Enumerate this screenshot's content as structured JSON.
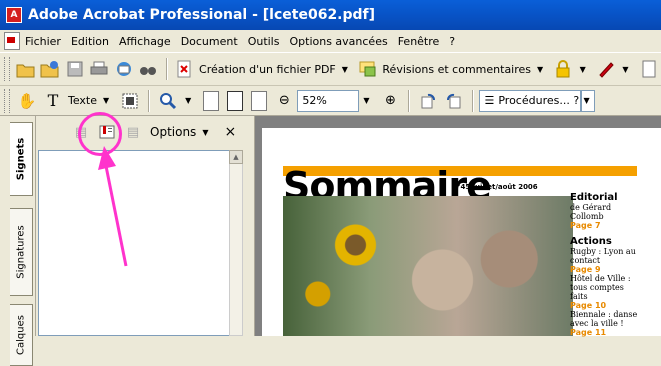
{
  "window": {
    "title": "Adobe Acrobat Professional - [lcete062.pdf]"
  },
  "menu": [
    "Fichier",
    "Edition",
    "Affichage",
    "Document",
    "Outils",
    "Options avancées",
    "Fenêtre",
    "?"
  ],
  "toolbar1": {
    "create_pdf_label": "Création d'un fichier PDF",
    "review_label": "Révisions et commentaires"
  },
  "toolbar2": {
    "select_tool_label": "Texte",
    "zoom_value": "52%",
    "procedures_label": "Procédures... ?"
  },
  "nav_panel": {
    "tabs": [
      "Signets",
      "Signatures",
      "Calques"
    ],
    "options_label": "Options",
    "close_glyph": "×"
  },
  "document": {
    "heading": "Sommaire",
    "issue": "n°45 juillet/août 2006",
    "sections": [
      {
        "title": "Editorial",
        "text": "de Gérard Collomb",
        "page": "Page 7"
      },
      {
        "title": "Actions",
        "text": "Rugby : Lyon au contact",
        "page": "Page 9"
      }
    ],
    "items": [
      {
        "text": "Hôtel de Ville : tous comptes faits",
        "page": "Page 10"
      },
      {
        "text": "Biennale : danse avec la ville !",
        "page": "Page 11"
      }
    ]
  },
  "colors": {
    "titlebar": "#0853c6",
    "highlight": "#ff33cc",
    "orange": "#f5a000"
  }
}
